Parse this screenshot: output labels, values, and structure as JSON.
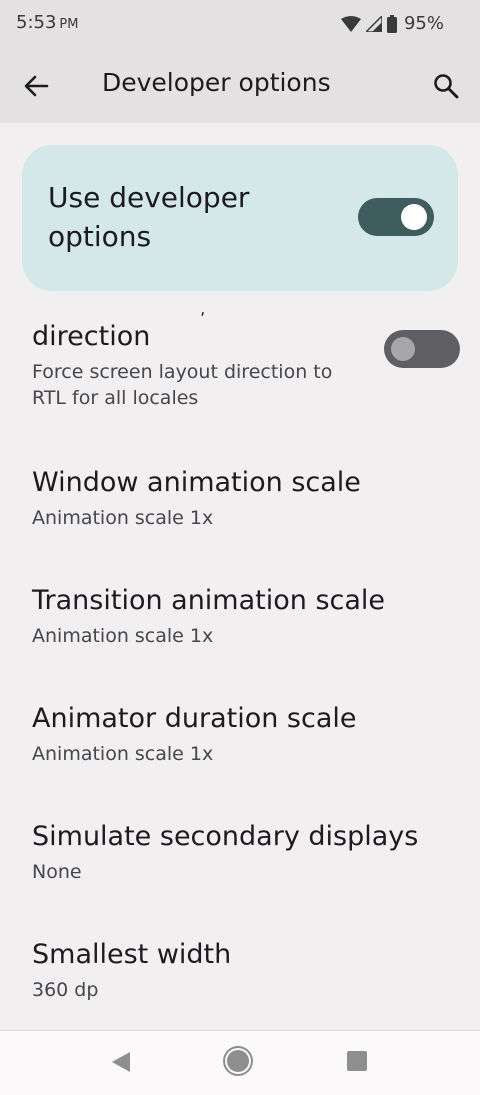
{
  "status_bar": {
    "time": "5:53",
    "ampm": "PM",
    "battery": "95%"
  },
  "app_bar": {
    "title": "Developer options"
  },
  "main_toggle": {
    "label": "Use developer options",
    "enabled": true
  },
  "settings": [
    {
      "title": "direction",
      "summary": "Force screen layout direction to RTL for all locales",
      "has_toggle": true,
      "enabled": false
    },
    {
      "title": "Window animation scale",
      "summary": "Animation scale 1x"
    },
    {
      "title": "Transition animation scale",
      "summary": "Animation scale 1x"
    },
    {
      "title": "Animator duration scale",
      "summary": "Animation scale 1x"
    },
    {
      "title": "Simulate secondary displays",
      "summary": "None"
    },
    {
      "title": "Smallest width",
      "summary": "360 dp"
    }
  ],
  "colors": {
    "background": "#f2eff1",
    "app_bar": "#e3e1e2",
    "card": "#d4e8e9",
    "toggle_on": "#3f5d5f",
    "toggle_off": "#5f5e62"
  },
  "icons": {
    "back": "arrow-left-icon",
    "search": "search-icon",
    "wifi": "wifi-icon",
    "signal": "signal-icon",
    "battery": "battery-icon"
  }
}
